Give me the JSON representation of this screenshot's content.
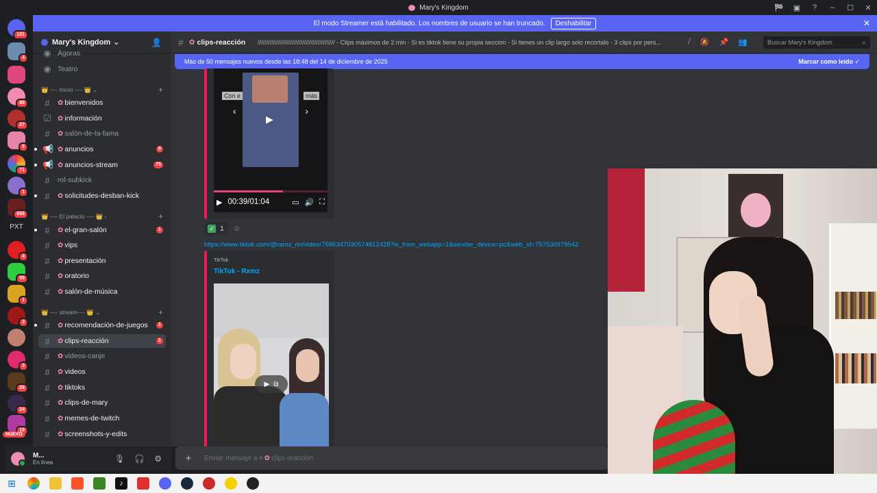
{
  "window": {
    "title": "Mary's Kingdom",
    "controls": [
      "🏁",
      "▣",
      "?",
      "–",
      "☐",
      "✕"
    ]
  },
  "banner": {
    "message": "El modo Streamer está habilitado. Los nombres de usuario se han truncado.",
    "button_label": "Deshabilitar",
    "close": "✕"
  },
  "servers": {
    "badges": [
      "121",
      "4",
      "88",
      "27",
      "5",
      "71",
      "1",
      "656",
      "4",
      "55",
      "1",
      "3",
      "3",
      "26",
      "24",
      "19"
    ],
    "text_item": "PXT",
    "new_label": "NUEVO"
  },
  "guild": {
    "name": "Mary's Kingdom",
    "caret": "⌄"
  },
  "channels": {
    "top_items": [
      {
        "label": "Ágoras"
      },
      {
        "label": "Teatro"
      }
    ],
    "categories": [
      {
        "label": "👑 ---- Inicio ---- 👑  ⌄"
      },
      {
        "label": "👑 ---- El palacio ---- 👑  ›"
      },
      {
        "label": "👑 ---- stream---- 👑  ⌄"
      }
    ],
    "items": [
      {
        "label": "bienvenidos",
        "flower": "✿"
      },
      {
        "label": "información",
        "flower": "✿"
      },
      {
        "label": "salón-de-la-fama",
        "flower": "✿"
      },
      {
        "label": "anuncios",
        "flower": "✿",
        "badge": "8"
      },
      {
        "label": "anuncios-stream",
        "flower": "✿",
        "badge": "75"
      },
      {
        "label": "rol-subkick"
      },
      {
        "label": "solicitudes-desban-kick",
        "flower": "✿"
      },
      {
        "label": "el-gran-salón",
        "flower": "✿",
        "badge": "1"
      },
      {
        "label": "vips",
        "flower": "✿"
      },
      {
        "label": "presentación",
        "flower": "✿"
      },
      {
        "label": "oratorio",
        "flower": "✿"
      },
      {
        "label": "salón-de-música",
        "flower": "✿"
      },
      {
        "label": "recomendación-de-juegos",
        "flower": "✿",
        "badge": "1"
      },
      {
        "label": "clips-reacción",
        "flower": "✿",
        "badge": "1"
      },
      {
        "label": "videos-canje",
        "flower": "✿"
      },
      {
        "label": "videos",
        "flower": "✿"
      },
      {
        "label": "tiktoks",
        "flower": "✿"
      },
      {
        "label": "clips-de-mary",
        "flower": "✿"
      },
      {
        "label": "memes-de-twitch",
        "flower": "✿"
      },
      {
        "label": "screenshots-y-edits",
        "flower": "✿"
      }
    ]
  },
  "user": {
    "name": "M...",
    "status": "En línea"
  },
  "chat": {
    "channel_name": "clips-reacción",
    "topic": "///////////////////////////////////////////// - Clips máximos de 2 min - Si es tiktok tiene su propia seccion - Si tienes un clip largo solo recortalo - 3 clips por pers...",
    "search_placeholder": "Buscar Mary's Kingdom",
    "new_messages": "Más de 50 mensajes nuevos desde las 18:48 del 14 de diciembre de 2025",
    "mark_read": "Marcar como leído",
    "video1": {
      "caption_left": "Con e",
      "caption_right": "más",
      "time": "00:39/01:04",
      "progress": 0.61
    },
    "reaction": {
      "emoji": "✓",
      "count": "1"
    },
    "link": "https://www.tiktok.com/@ramz_rin/video/7586347030574812428?is_from_webapp=1&sender_device=pc&web_id=757530979542",
    "embed2": {
      "provider": "TikTok",
      "title": "TikTok - Rxmz"
    },
    "composer_placeholder": "Enviar mensaje a #",
    "composer_channel": "clips-reacción"
  }
}
